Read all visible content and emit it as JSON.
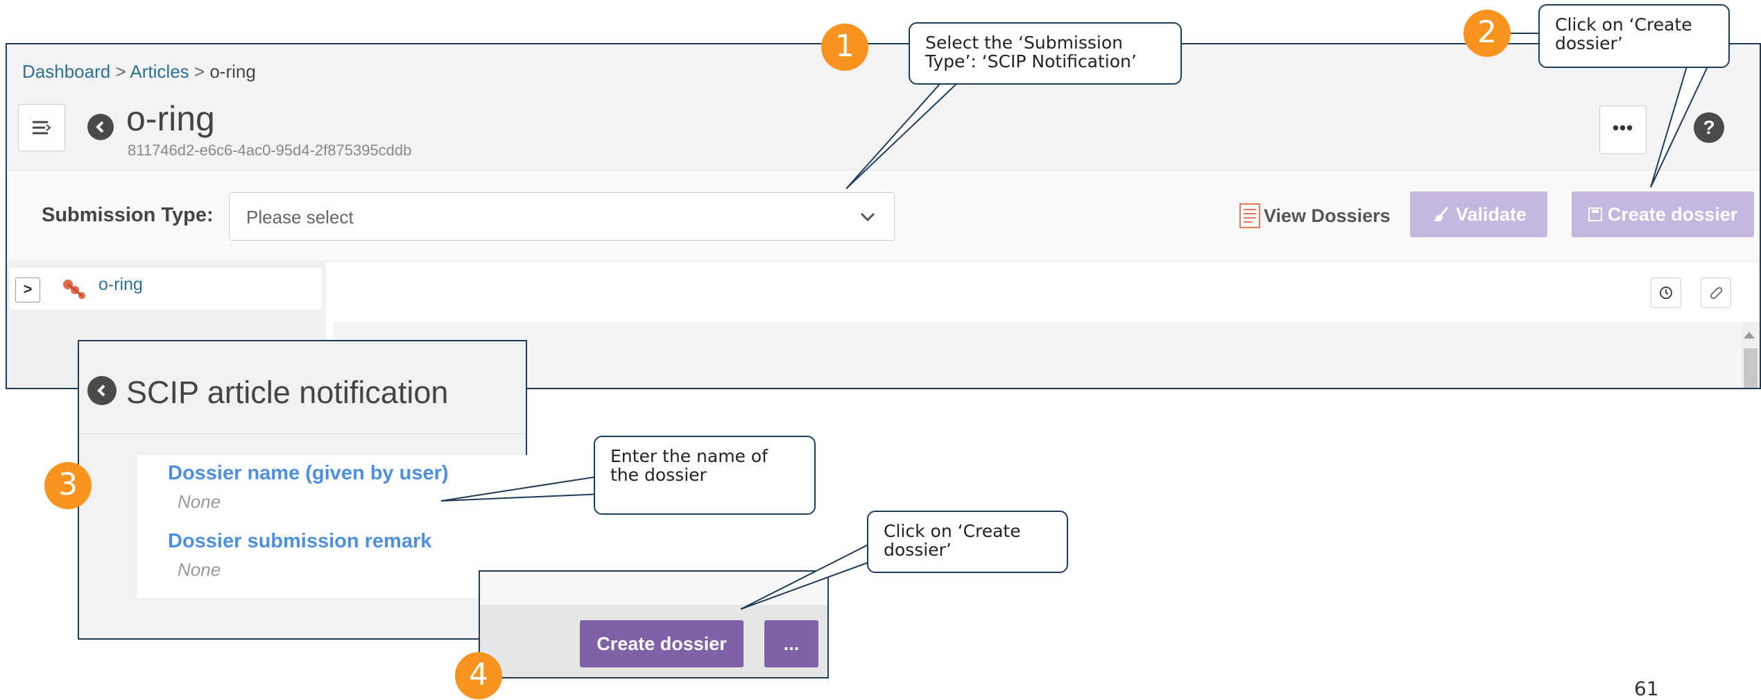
{
  "header": {
    "breadcrumb": {
      "dashboard": "Dashboard",
      "sep1": ">",
      "articles": "Articles",
      "sep2": ">",
      "current": "o-ring"
    },
    "title": "o-ring",
    "uuid": "811746d2-e6c6-4ac0-95d4-2f875395cddb",
    "more_label": "•••",
    "help_label": "?"
  },
  "submission": {
    "label": "Submission Type:",
    "placeholder": "Please select",
    "view_dossiers_label": "View Dossiers",
    "validate_label": "Validate",
    "create_dossier_label": "Create dossier"
  },
  "tree": {
    "expander": ">",
    "item_label": "o-ring"
  },
  "scip": {
    "title": "SCIP article notification",
    "fields": [
      {
        "label": "Dossier name (given by user)",
        "value": "None"
      },
      {
        "label": "Dossier submission remark",
        "value": "None"
      }
    ]
  },
  "footer_panel": {
    "create_dossier_label": "Create dossier",
    "more_label": "..."
  },
  "callouts": {
    "c1": "Select the ‘Submission Type’: ‘SCIP Notification’",
    "c2": "Click on ‘Create dossier’",
    "c3": "Enter the name of the dossier",
    "c4": "Click on ‘Create dossier’"
  },
  "steps": [
    "1",
    "2",
    "3",
    "4"
  ],
  "page_number": "61",
  "colors": {
    "accent_purple": "#7f61a7",
    "light_purple": "#c4b8de",
    "step_orange": "#f7941d",
    "link_blue": "#2f6f94",
    "field_blue": "#4d8fe0",
    "border_navy": "#1f3b57"
  }
}
